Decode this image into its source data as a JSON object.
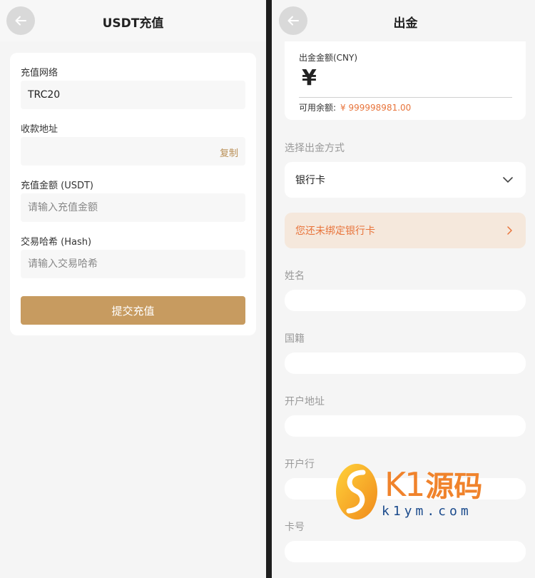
{
  "left": {
    "title": "USDT充值",
    "network_label": "充值网络",
    "network_value": "TRC20",
    "address_label": "收款地址",
    "address_value": "",
    "copy_label": "复制",
    "amount_label": "充值金额 (USDT)",
    "amount_placeholder": "请输入充值金额",
    "hash_label": "交易哈希 (Hash)",
    "hash_placeholder": "请输入交易哈希",
    "submit_label": "提交充值"
  },
  "right": {
    "title": "出金",
    "amount_label": "出金金额(CNY)",
    "currency_symbol": "¥",
    "balance_label": "可用余额:",
    "balance_value": "¥ 999998981.00",
    "method_label": "选择出金方式",
    "method_value": "银行卡",
    "notice_text": "您还未绑定银行卡",
    "fields": [
      {
        "label": "姓名"
      },
      {
        "label": "国籍"
      },
      {
        "label": "开户地址"
      },
      {
        "label": "开户行"
      },
      {
        "label": "卡号"
      }
    ]
  },
  "watermark": {
    "brand_latin": "K1",
    "brand_cn": "源码",
    "url": "k1ym.com"
  },
  "colors": {
    "accent": "#c79b60",
    "orange": "#e8743b",
    "notice_bg": "#f5e8dc"
  }
}
